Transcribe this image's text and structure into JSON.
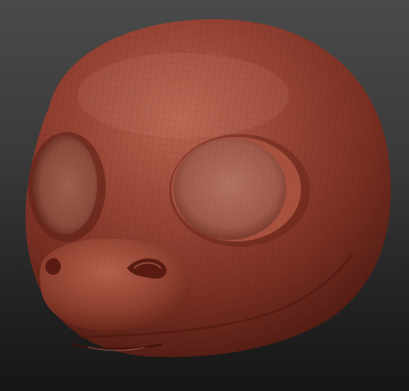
{
  "scene": {
    "background": [
      "#4a4a4a",
      "#161616"
    ],
    "subject": "sculpted-creature-head",
    "material_color": "#8a3a2c",
    "wireframe_visible": true
  }
}
